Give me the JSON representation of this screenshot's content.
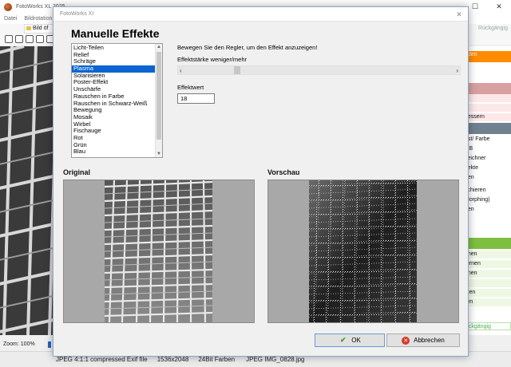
{
  "app": {
    "title": "FotoWorks XL 2025",
    "menu": [
      "Datei",
      "Bildrotation"
    ],
    "image_tab": "Bild öf",
    "right_toolbar_label": "Rückgängig",
    "zoom": "Zoom: 100%",
    "right_panel": [
      {
        "label": "nden",
        "color": "#ff8c00",
        "head": true
      },
      {
        "label": "",
        "color": "#d9a0a0",
        "head": true
      },
      {
        "label": "n",
        "color": "#fde8e8",
        "head": false
      },
      {
        "label": "n",
        "color": "#fde8e8",
        "head": false
      },
      {
        "label": "bessern",
        "color": "#fde8e8",
        "head": false
      },
      {
        "label": "",
        "color": "#708090",
        "head": true
      },
      {
        "label": "ast/ Farbe",
        "color": "#ffffff",
        "head": false
      },
      {
        "label": "GB",
        "color": "#ffffff",
        "head": false
      },
      {
        "label": "zeichner",
        "color": "#ffffff",
        "head": false
      },
      {
        "label": "ffekte",
        "color": "#ffffff",
        "head": false
      },
      {
        "label": "gen",
        "color": "#ffffff",
        "head": false
      },
      {
        "label": "schieren",
        "color": "#ffffff",
        "head": false
      },
      {
        "label": "Morphing)",
        "color": "#ffffff",
        "head": false
      },
      {
        "label": "gen",
        "color": "#ffffff",
        "head": false
      },
      {
        "label": "e",
        "color": "#ffffff",
        "head": false
      },
      {
        "label": "n",
        "color": "#ffffff",
        "head": false
      },
      {
        "label": "",
        "color": "#7fbf3f",
        "head": true
      },
      {
        "label": "onen",
        "color": "#eef7e4",
        "head": false
      },
      {
        "label": "fernen",
        "color": "#eef7e4",
        "head": false
      },
      {
        "label": "nnen",
        "color": "#eef7e4",
        "head": false
      },
      {
        "label": "n",
        "color": "#eef7e4",
        "head": false
      },
      {
        "label": "nien",
        "color": "#eef7e4",
        "head": false
      },
      {
        "label": "ren",
        "color": "#eef7e4",
        "head": false
      },
      {
        "label": "ückgängig",
        "color": "#ffffff",
        "head": false
      }
    ]
  },
  "status": {
    "format": "JPEG 4:1:1 compressed Exif file",
    "dimensions": "1536x2048",
    "color_depth": "24Bit Farben",
    "filename": "JPEG IMG_0828.jpg"
  },
  "dialog": {
    "window_title": "FotoWorks XI",
    "heading": "Manuelle Effekte",
    "effects": [
      "Licht-Teilen",
      "Relief",
      "Schräge",
      "Plasma",
      "Solarisieren",
      "Poster-Effekt",
      "Unschärfe",
      "Rauschen in Farbe",
      "Rauschen in Schwarz-Weiß",
      "Bewegung",
      "Mosaik",
      "Wirbel",
      "Fischauge",
      "Rot",
      "Grün",
      "Blau"
    ],
    "selected_effect": "Plasma",
    "instruction": "Bewegen Sie den Regler, um den Effekt anzuzeigen!",
    "strength_label": "Effektstärke weniger/mehr",
    "slider_left": "‹",
    "slider_right": "›",
    "slider_level": 0.18,
    "value_label": "Effektwert",
    "value": "18",
    "original_heading": "Original",
    "preview_heading": "Vorschau",
    "ok_label": "OK",
    "cancel_label": "Abbrechen"
  },
  "icons": {
    "ok": "checkmark-icon",
    "cancel": "cancel-icon",
    "close": "close-icon",
    "logo": "app-logo-icon"
  }
}
